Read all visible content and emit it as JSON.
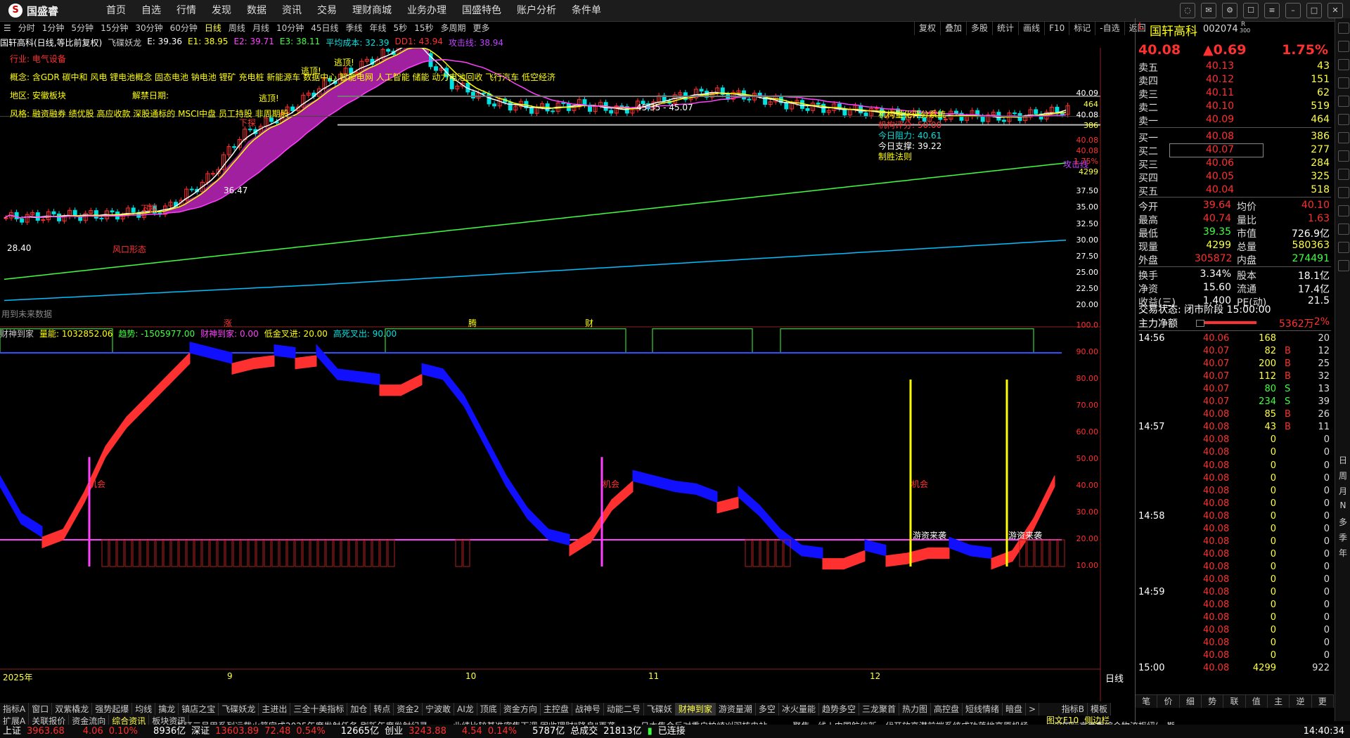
{
  "menubar": {
    "logo": "国盛睿",
    "items": [
      "首页",
      "自选",
      "行情",
      "发现",
      "数据",
      "资讯",
      "交易",
      "理财商城",
      "业务办理",
      "国盛特色",
      "账户分析",
      "条件单"
    ]
  },
  "periods": [
    "分时",
    "1分钟",
    "5分钟",
    "15分钟",
    "30分钟",
    "60分钟",
    "日线",
    "周线",
    "月线",
    "10分钟",
    "45日线",
    "季线",
    "年线",
    "5秒",
    "15秒",
    "多周期",
    "更多"
  ],
  "active_period": "日线",
  "right_tools": [
    "复权",
    "叠加",
    "多股",
    "统计",
    "画线",
    "F10",
    "标记",
    "-自选",
    "返回"
  ],
  "info": {
    "name": "国轩高科(日线,等比前复权)",
    "ind1": "飞碟妖龙",
    "e": "E: 39.36",
    "e1": "E1: 38.95",
    "e2": "E2: 39.71",
    "e3": "E3: 38.11",
    "avgcost": "平均成本: 32.39",
    "dd1": "DD1: 43.94",
    "attack": "攻击线: 38.94"
  },
  "annotations": {
    "industry": "行业: 电气设备",
    "concept": "概念: 含GDR 碳中和 风电 锂电池概念 固态电池 钠电池 锂矿 充电桩 新能源车 数据中心 智能电网 人工智能 储能 动力电池回收 飞行汽车 低空经济",
    "region": "地区: 安徽板块",
    "unlock": "解禁日期:",
    "style": "风格: 融资融券 绩优股 高应收款 深股通标的 MSCI中盘 员工持股 非周期股"
  },
  "chart_labels": {
    "rangebox": "45.35 - 45.07",
    "price_low": "28.40",
    "price_mid": "36.47",
    "xiadie": "下探",
    "chance": "机会",
    "youzi": "游资来袭",
    "xiaoyang": "低点",
    "pattern": "风口形态",
    "quant_title": "机构量化评分系统",
    "quant_score": "机构评分: 50.00",
    "quant_resist": "今日阻力: 40.61",
    "quant_support": "今日支撑: 39.22",
    "quant_risk": "制胜法则",
    "attack_line": "攻击线",
    "future_data": "用到未来数据",
    "month_rows": [
      "2025年",
      "9",
      "10",
      "11",
      "12"
    ],
    "lower_markers": [
      "涨",
      "腾",
      "财"
    ],
    "escape": "逃顶!"
  },
  "price_axis": [
    "40.09",
    "464",
    "40.08",
    "386",
    "40.08",
    "40.08",
    "1.75%",
    "4299",
    "37.50",
    "35.00",
    "32.50",
    "30.00",
    "27.50",
    "25.00",
    "22.50",
    "20.00"
  ],
  "ind_axis": [
    "100.0",
    "90.00",
    "80.00",
    "70.00",
    "60.00",
    "50.00",
    "40.00",
    "30.00",
    "20.00",
    "10.00"
  ],
  "ind_info": {
    "name": "财神到家",
    "v1": "量能: 1032852.06",
    "v2": "趋势: -1505977.00",
    "v3": "财神到家: 0.00",
    "v4": "低金叉进: 20.00",
    "v5": "高死叉出: 90.00"
  },
  "timeframe_label": "日线",
  "quote": {
    "market": "L",
    "name": "国轩高科",
    "code": "002074",
    "r_tag": "R",
    "r_sub": "300",
    "price": "40.08",
    "change": "▲0.69",
    "pct": "1.75%",
    "asks": [
      {
        "label": "卖五",
        "price": "40.13",
        "vol": "43"
      },
      {
        "label": "卖四",
        "price": "40.12",
        "vol": "151"
      },
      {
        "label": "卖三",
        "price": "40.11",
        "vol": "62"
      },
      {
        "label": "卖二",
        "price": "40.10",
        "vol": "519"
      },
      {
        "label": "卖一",
        "price": "40.09",
        "vol": "464"
      }
    ],
    "bids": [
      {
        "label": "买一",
        "price": "40.08",
        "vol": "386"
      },
      {
        "label": "买二",
        "price": "40.07",
        "vol": "277"
      },
      {
        "label": "买三",
        "price": "40.06",
        "vol": "284"
      },
      {
        "label": "买四",
        "price": "40.05",
        "vol": "325"
      },
      {
        "label": "买五",
        "price": "40.04",
        "vol": "518"
      }
    ],
    "stats": [
      {
        "k1": "今开",
        "v1": "39.64",
        "k2": "均价",
        "v2": "40.10"
      },
      {
        "k1": "最高",
        "v1": "40.74",
        "k2": "量比",
        "v2": "1.63"
      },
      {
        "k1": "最低",
        "v1": "39.35",
        "k2": "市值",
        "v2": "726.9亿"
      },
      {
        "k1": "现量",
        "v1": "4299",
        "k2": "总量",
        "v2": "580363"
      },
      {
        "k1": "外盘",
        "v1": "305872",
        "k2": "内盘",
        "v2": "274491"
      },
      {
        "k1": "换手",
        "v1": "3.34%",
        "k2": "股本",
        "v2": "18.1亿"
      },
      {
        "k1": "净资",
        "v1": "15.60",
        "k2": "流通",
        "v2": "17.4亿"
      },
      {
        "k1": "收益(三)",
        "v1": "1.400",
        "k2": "PE(动)",
        "v2": "21.5"
      }
    ],
    "trade_state": "交易状态: 闭市阶段 15:00:00",
    "main_flow_label": "主力净额",
    "main_flow": "5362万",
    "main_flow_pct": "2%"
  },
  "ticks": [
    {
      "t": "14:56",
      "p": "40.06",
      "v": "168",
      "f": "",
      "n": "20"
    },
    {
      "t": "",
      "p": "40.07",
      "v": "82",
      "f": "B",
      "n": "12"
    },
    {
      "t": "",
      "p": "40.07",
      "v": "200",
      "f": "B",
      "n": "25"
    },
    {
      "t": "",
      "p": "40.07",
      "v": "112",
      "f": "B",
      "n": "32"
    },
    {
      "t": "",
      "p": "40.07",
      "v": "80",
      "f": "S",
      "n": "13"
    },
    {
      "t": "",
      "p": "40.07",
      "v": "234",
      "f": "S",
      "n": "39"
    },
    {
      "t": "",
      "p": "40.08",
      "v": "85",
      "f": "B",
      "n": "26"
    },
    {
      "t": "14:57",
      "p": "40.08",
      "v": "43",
      "f": "B",
      "n": "11"
    },
    {
      "t": "",
      "p": "40.08",
      "v": "0",
      "f": "",
      "n": "0"
    },
    {
      "t": "",
      "p": "40.08",
      "v": "0",
      "f": "",
      "n": "0"
    },
    {
      "t": "",
      "p": "40.08",
      "v": "0",
      "f": "",
      "n": "0"
    },
    {
      "t": "",
      "p": "40.08",
      "v": "0",
      "f": "",
      "n": "0"
    },
    {
      "t": "",
      "p": "40.08",
      "v": "0",
      "f": "",
      "n": "0"
    },
    {
      "t": "",
      "p": "40.08",
      "v": "0",
      "f": "",
      "n": "0"
    },
    {
      "t": "14:58",
      "p": "40.08",
      "v": "0",
      "f": "",
      "n": "0"
    },
    {
      "t": "",
      "p": "40.08",
      "v": "0",
      "f": "",
      "n": "0"
    },
    {
      "t": "",
      "p": "40.08",
      "v": "0",
      "f": "",
      "n": "0"
    },
    {
      "t": "",
      "p": "40.08",
      "v": "0",
      "f": "",
      "n": "0"
    },
    {
      "t": "",
      "p": "40.08",
      "v": "0",
      "f": "",
      "n": "0"
    },
    {
      "t": "",
      "p": "40.08",
      "v": "0",
      "f": "",
      "n": "0"
    },
    {
      "t": "14:59",
      "p": "40.08",
      "v": "0",
      "f": "",
      "n": "0"
    },
    {
      "t": "",
      "p": "40.08",
      "v": "0",
      "f": "",
      "n": "0"
    },
    {
      "t": "",
      "p": "40.08",
      "v": "0",
      "f": "",
      "n": "0"
    },
    {
      "t": "",
      "p": "40.08",
      "v": "0",
      "f": "",
      "n": "0"
    },
    {
      "t": "",
      "p": "40.08",
      "v": "0",
      "f": "",
      "n": "0"
    },
    {
      "t": "",
      "p": "40.08",
      "v": "0",
      "f": "",
      "n": "0"
    },
    {
      "t": "15:00",
      "p": "40.08",
      "v": "4299",
      "f": "",
      "n": "922"
    }
  ],
  "quote_bottom_tabs": [
    "笔",
    "价",
    "细",
    "势",
    "联",
    "值",
    "主",
    "逆",
    "更"
  ],
  "right_side_icons": [
    "日",
    "周",
    "月",
    "N",
    "多",
    "季",
    "年"
  ],
  "indicator_tabs": [
    "指标A",
    "窗口",
    "双紫橇龙",
    "强势起爆",
    "均线",
    "擒龙",
    "镇店之宝",
    "飞碟妖龙",
    "主进出",
    "三全十美指标",
    "加仓",
    "转点",
    "资金2",
    "宁波敢",
    "AI龙",
    "顶底",
    "资金方向",
    "主控盘",
    "战神号",
    "动能二号",
    "飞碟妖",
    "财神到家",
    "游资量潮",
    "多空",
    "冰火量能",
    "趋势多空",
    "三龙聚首",
    "热力图",
    "高控盘",
    "短线情绪",
    "暗盘"
  ],
  "indicator_tabs_right": [
    "指标B",
    "模板"
  ],
  "tabs2": [
    "扩展A",
    "关联报价",
    "资金流向",
    "综合资讯",
    "板块资讯"
  ],
  "tabs2_right": [
    "图文F10",
    "侧边栏"
  ],
  "news": [
    "长证三号甲系列运载火箭完成2025年度发射任务 刷新年度发射纪录",
    "业绩比较基准密集下调 固收理财\"降息\"再袭",
    "日本集会反对重启柏崎刈羽核电站",
    "聚焦一线 | 中国航信新一代开放高潜前端系统成功落地高原机场",
    "深国际京西南综合物流枢纽(一期)智慧物流中心项目主体结构顺利封",
    "国家数据局: 探索建立数据利"
  ],
  "status": {
    "sh_label": "上证",
    "sh_val": "3963.68",
    "sh_chg": "4.06",
    "sh_pct": "0.10%",
    "sh_amt": "8936亿",
    "sz_label": "深证",
    "sz_val": "13603.89",
    "sz_chg": "72.48",
    "sz_pct": "0.54%",
    "sz_amt": "12665亿",
    "cy_label": "创业",
    "cy_val": "3243.88",
    "cy_chg": "4.54",
    "cy_pct": "0.14%",
    "cy_amt": "5787亿",
    "total_label": "总成交",
    "total_amt": "21813亿",
    "conn": "已连接",
    "time": "14:40:34"
  },
  "colors": {
    "up": "#ff3030",
    "down": "#00e0e0",
    "ma1": "#ffffff",
    "ma2": "#ffff00",
    "ma3": "#ff40ff",
    "ma4": "#40ff40",
    "ma5": "#00c0ff"
  }
}
